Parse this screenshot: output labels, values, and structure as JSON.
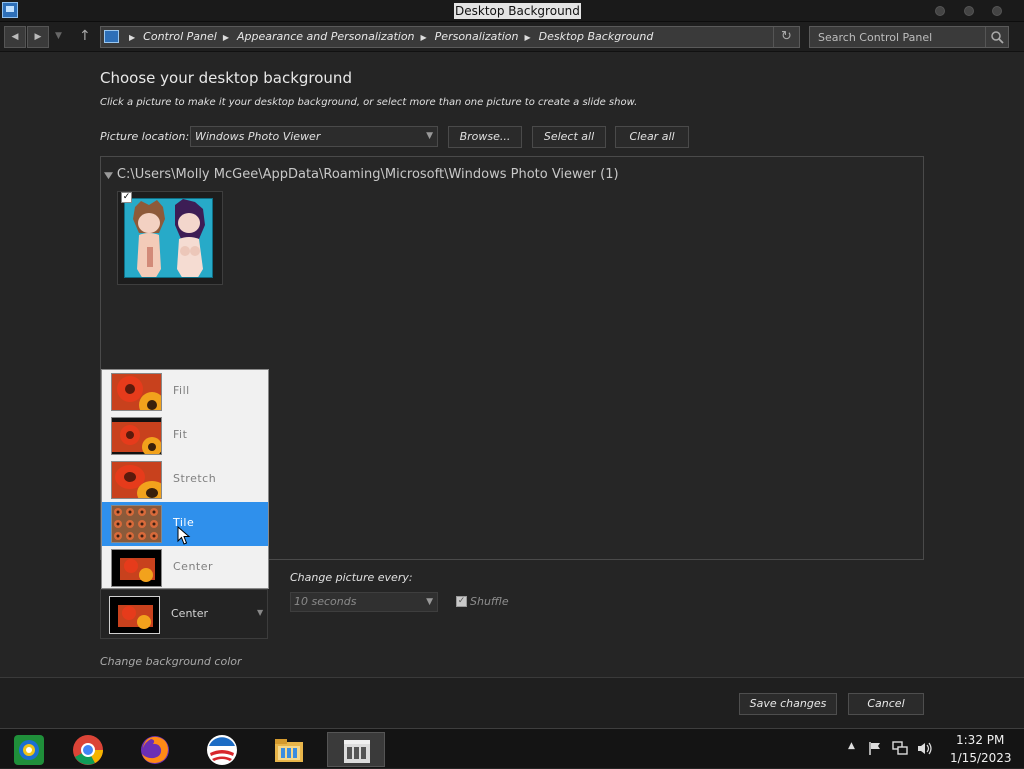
{
  "window": {
    "title": "Desktop Background"
  },
  "address": {
    "breadcrumb": [
      "Control Panel",
      "Appearance and Personalization",
      "Personalization",
      "Desktop Background"
    ],
    "search_placeholder": "Search Control Panel"
  },
  "main": {
    "heading": "Choose your desktop background",
    "subheading": "Click a picture to make it your desktop background, or select more than one picture to create a slide show.",
    "picture_location_label": "Picture location:",
    "picture_location_value": "Windows Photo Viewer",
    "browse_label": "Browse...",
    "select_all_label": "Select all",
    "clear_all_label": "Clear all",
    "group_header": "C:\\Users\\Molly McGee\\AppData\\Roaming\\Microsoft\\Windows Photo Viewer (1)"
  },
  "position": {
    "options": [
      "Fill",
      "Fit",
      "Stretch",
      "Tile",
      "Center"
    ],
    "highlighted": "Tile",
    "current": "Center"
  },
  "slideshow": {
    "change_label": "Change picture every:",
    "interval": "10 seconds",
    "shuffle_label": "Shuffle",
    "shuffle_checked": true
  },
  "background_color_link": "Change background color",
  "footer": {
    "save_label": "Save changes",
    "cancel_label": "Cancel"
  },
  "taskbar": {
    "icons": [
      "windows-media-center-icon",
      "chrome-icon",
      "firefox-icon",
      "campaign-logo-icon",
      "file-explorer-icon",
      "control-panel-icon"
    ],
    "clock_time": "1:32 PM",
    "clock_date": "1/15/2023"
  },
  "colors": {
    "highlight": "#2f90ec",
    "background": "#252525",
    "thumb_bg": "#27aac8"
  }
}
